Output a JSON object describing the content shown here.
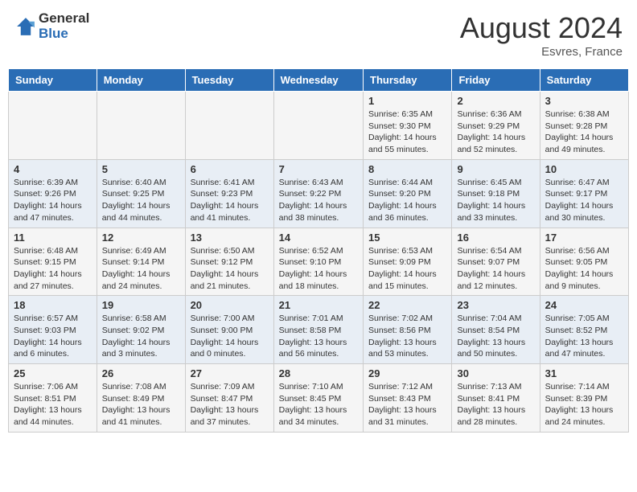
{
  "header": {
    "logo_general": "General",
    "logo_blue": "Blue",
    "month_year": "August 2024",
    "location": "Esvres, France"
  },
  "weekdays": [
    "Sunday",
    "Monday",
    "Tuesday",
    "Wednesday",
    "Thursday",
    "Friday",
    "Saturday"
  ],
  "weeks": [
    [
      {
        "day": "",
        "info": ""
      },
      {
        "day": "",
        "info": ""
      },
      {
        "day": "",
        "info": ""
      },
      {
        "day": "",
        "info": ""
      },
      {
        "day": "1",
        "info": "Sunrise: 6:35 AM\nSunset: 9:30 PM\nDaylight: 14 hours\nand 55 minutes."
      },
      {
        "day": "2",
        "info": "Sunrise: 6:36 AM\nSunset: 9:29 PM\nDaylight: 14 hours\nand 52 minutes."
      },
      {
        "day": "3",
        "info": "Sunrise: 6:38 AM\nSunset: 9:28 PM\nDaylight: 14 hours\nand 49 minutes."
      }
    ],
    [
      {
        "day": "4",
        "info": "Sunrise: 6:39 AM\nSunset: 9:26 PM\nDaylight: 14 hours\nand 47 minutes."
      },
      {
        "day": "5",
        "info": "Sunrise: 6:40 AM\nSunset: 9:25 PM\nDaylight: 14 hours\nand 44 minutes."
      },
      {
        "day": "6",
        "info": "Sunrise: 6:41 AM\nSunset: 9:23 PM\nDaylight: 14 hours\nand 41 minutes."
      },
      {
        "day": "7",
        "info": "Sunrise: 6:43 AM\nSunset: 9:22 PM\nDaylight: 14 hours\nand 38 minutes."
      },
      {
        "day": "8",
        "info": "Sunrise: 6:44 AM\nSunset: 9:20 PM\nDaylight: 14 hours\nand 36 minutes."
      },
      {
        "day": "9",
        "info": "Sunrise: 6:45 AM\nSunset: 9:18 PM\nDaylight: 14 hours\nand 33 minutes."
      },
      {
        "day": "10",
        "info": "Sunrise: 6:47 AM\nSunset: 9:17 PM\nDaylight: 14 hours\nand 30 minutes."
      }
    ],
    [
      {
        "day": "11",
        "info": "Sunrise: 6:48 AM\nSunset: 9:15 PM\nDaylight: 14 hours\nand 27 minutes."
      },
      {
        "day": "12",
        "info": "Sunrise: 6:49 AM\nSunset: 9:14 PM\nDaylight: 14 hours\nand 24 minutes."
      },
      {
        "day": "13",
        "info": "Sunrise: 6:50 AM\nSunset: 9:12 PM\nDaylight: 14 hours\nand 21 minutes."
      },
      {
        "day": "14",
        "info": "Sunrise: 6:52 AM\nSunset: 9:10 PM\nDaylight: 14 hours\nand 18 minutes."
      },
      {
        "day": "15",
        "info": "Sunrise: 6:53 AM\nSunset: 9:09 PM\nDaylight: 14 hours\nand 15 minutes."
      },
      {
        "day": "16",
        "info": "Sunrise: 6:54 AM\nSunset: 9:07 PM\nDaylight: 14 hours\nand 12 minutes."
      },
      {
        "day": "17",
        "info": "Sunrise: 6:56 AM\nSunset: 9:05 PM\nDaylight: 14 hours\nand 9 minutes."
      }
    ],
    [
      {
        "day": "18",
        "info": "Sunrise: 6:57 AM\nSunset: 9:03 PM\nDaylight: 14 hours\nand 6 minutes."
      },
      {
        "day": "19",
        "info": "Sunrise: 6:58 AM\nSunset: 9:02 PM\nDaylight: 14 hours\nand 3 minutes."
      },
      {
        "day": "20",
        "info": "Sunrise: 7:00 AM\nSunset: 9:00 PM\nDaylight: 14 hours\nand 0 minutes."
      },
      {
        "day": "21",
        "info": "Sunrise: 7:01 AM\nSunset: 8:58 PM\nDaylight: 13 hours\nand 56 minutes."
      },
      {
        "day": "22",
        "info": "Sunrise: 7:02 AM\nSunset: 8:56 PM\nDaylight: 13 hours\nand 53 minutes."
      },
      {
        "day": "23",
        "info": "Sunrise: 7:04 AM\nSunset: 8:54 PM\nDaylight: 13 hours\nand 50 minutes."
      },
      {
        "day": "24",
        "info": "Sunrise: 7:05 AM\nSunset: 8:52 PM\nDaylight: 13 hours\nand 47 minutes."
      }
    ],
    [
      {
        "day": "25",
        "info": "Sunrise: 7:06 AM\nSunset: 8:51 PM\nDaylight: 13 hours\nand 44 minutes."
      },
      {
        "day": "26",
        "info": "Sunrise: 7:08 AM\nSunset: 8:49 PM\nDaylight: 13 hours\nand 41 minutes."
      },
      {
        "day": "27",
        "info": "Sunrise: 7:09 AM\nSunset: 8:47 PM\nDaylight: 13 hours\nand 37 minutes."
      },
      {
        "day": "28",
        "info": "Sunrise: 7:10 AM\nSunset: 8:45 PM\nDaylight: 13 hours\nand 34 minutes."
      },
      {
        "day": "29",
        "info": "Sunrise: 7:12 AM\nSunset: 8:43 PM\nDaylight: 13 hours\nand 31 minutes."
      },
      {
        "day": "30",
        "info": "Sunrise: 7:13 AM\nSunset: 8:41 PM\nDaylight: 13 hours\nand 28 minutes."
      },
      {
        "day": "31",
        "info": "Sunrise: 7:14 AM\nSunset: 8:39 PM\nDaylight: 13 hours\nand 24 minutes."
      }
    ]
  ]
}
